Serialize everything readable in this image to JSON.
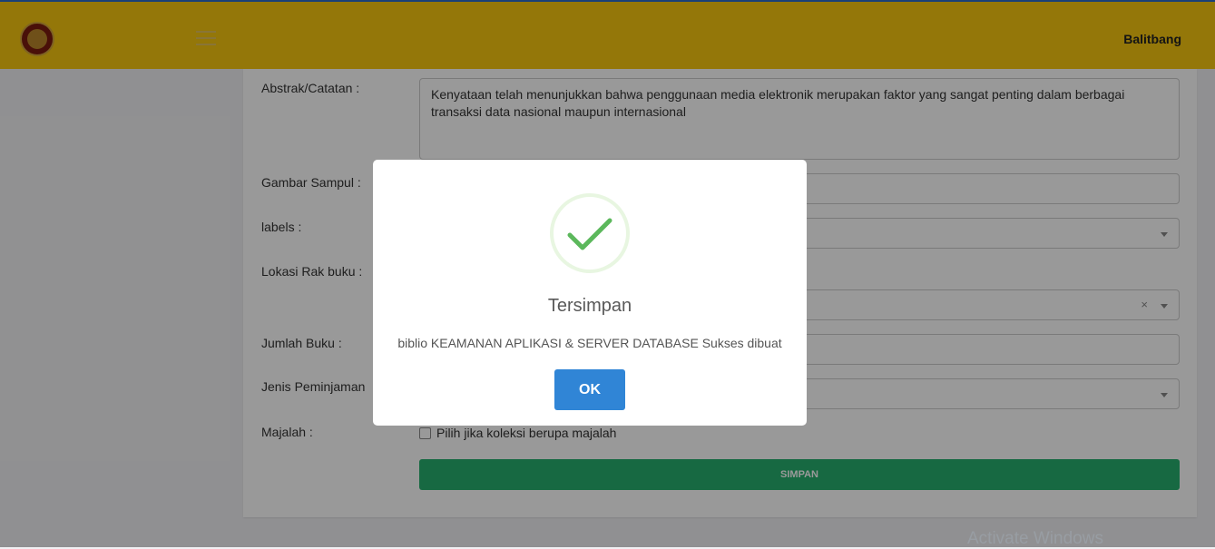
{
  "header": {
    "user_name": "Balitbang",
    "logo": "garuda-emblem-icon",
    "menu_icon": "hamburger-icon"
  },
  "form": {
    "abstrak": {
      "label": "Abstrak/Catatan :",
      "value": "Kenyataan telah menunjukkan bahwa penggunaan media elektronik merupakan faktor yang sangat penting dalam berbagai transaksi data nasional maupun internasional"
    },
    "gambar_sampul": {
      "label": "Gambar Sampul :",
      "value": ""
    },
    "labels": {
      "label": "labels :",
      "value": ""
    },
    "lokasi_rak": {
      "label": "Lokasi Rak buku :",
      "value": "",
      "clear": "×"
    },
    "jumlah_buku": {
      "label": "Jumlah Buku :",
      "value": ""
    },
    "jenis_peminjaman": {
      "label": "Jenis Peminjaman",
      "value": ""
    },
    "majalah": {
      "label": "Majalah :",
      "checkbox_label": "Pilih jika koleksi berupa majalah",
      "checked": false
    },
    "submit_label": "SIMPAN"
  },
  "modal": {
    "title": "Tersimpan",
    "message": "biblio KEAMANAN APLIKASI & SERVER DATABASE Sukses dibuat",
    "ok_label": "OK",
    "icon": "success-check-icon"
  },
  "watermark": "Activate Windows",
  "colors": {
    "header": "#f7c70f",
    "success": "#5cb85c",
    "ok_button": "#3085d6",
    "simpan_button": "#27b06e"
  }
}
